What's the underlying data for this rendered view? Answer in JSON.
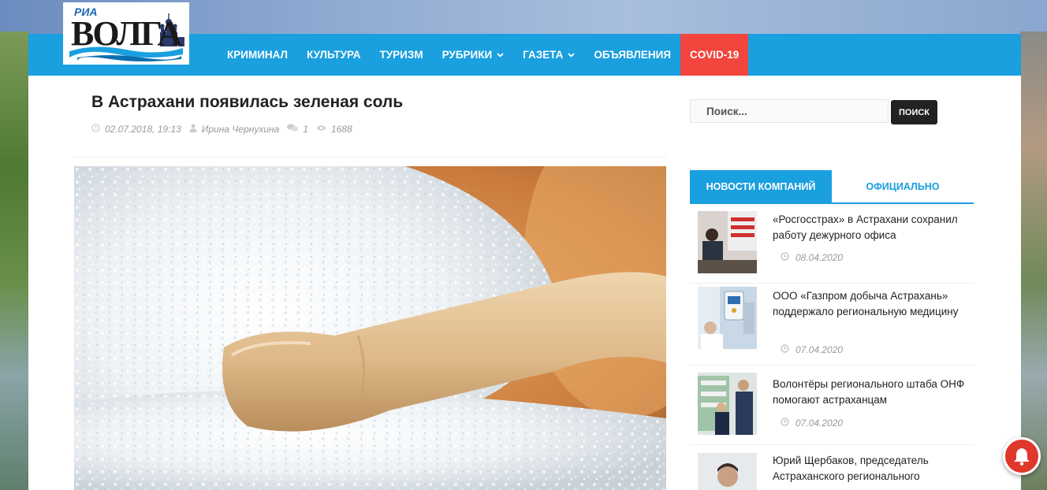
{
  "logo": {
    "top_text": "РИА",
    "word": "ВОЛГА"
  },
  "nav": {
    "items": [
      {
        "label": "Криминал",
        "dropdown": false
      },
      {
        "label": "Культура",
        "dropdown": false
      },
      {
        "label": "Туризм",
        "dropdown": false
      },
      {
        "label": "Рубрики",
        "dropdown": true
      },
      {
        "label": "Газета",
        "dropdown": true
      },
      {
        "label": "Объявления",
        "dropdown": false
      }
    ],
    "covid_label": "COVID-19"
  },
  "article": {
    "title": "В Астрахани появилась зеленая соль",
    "date": "02.07.2018, 19:13",
    "author": "Ирина Чернухина",
    "comments": "1",
    "views": "1688",
    "image_icon": "salt-bowl-photo"
  },
  "search": {
    "placeholder": "Поиск...",
    "button_label": "Поиск"
  },
  "tabs": {
    "active": "Новости компаний",
    "inactive": "Официально"
  },
  "news": [
    {
      "title": "«Росгосстрах» в Астрахани сохранил работу дежурного офиса",
      "date": "08.04.2020"
    },
    {
      "title": "ООО «Газпром добыча Астрахань» поддержало региональную медицину",
      "date": "07.04.2020"
    },
    {
      "title": "Волонтёры регионального штаба ОНФ помогают астраханцам",
      "date": "07.04.2020"
    },
    {
      "title": "Юрий Щербаков, председатель Астраханского регионального",
      "date": ""
    }
  ],
  "colors": {
    "nav_blue": "#1a9fdf",
    "covid_red": "#f2453d",
    "bell_red": "#e0372c"
  }
}
